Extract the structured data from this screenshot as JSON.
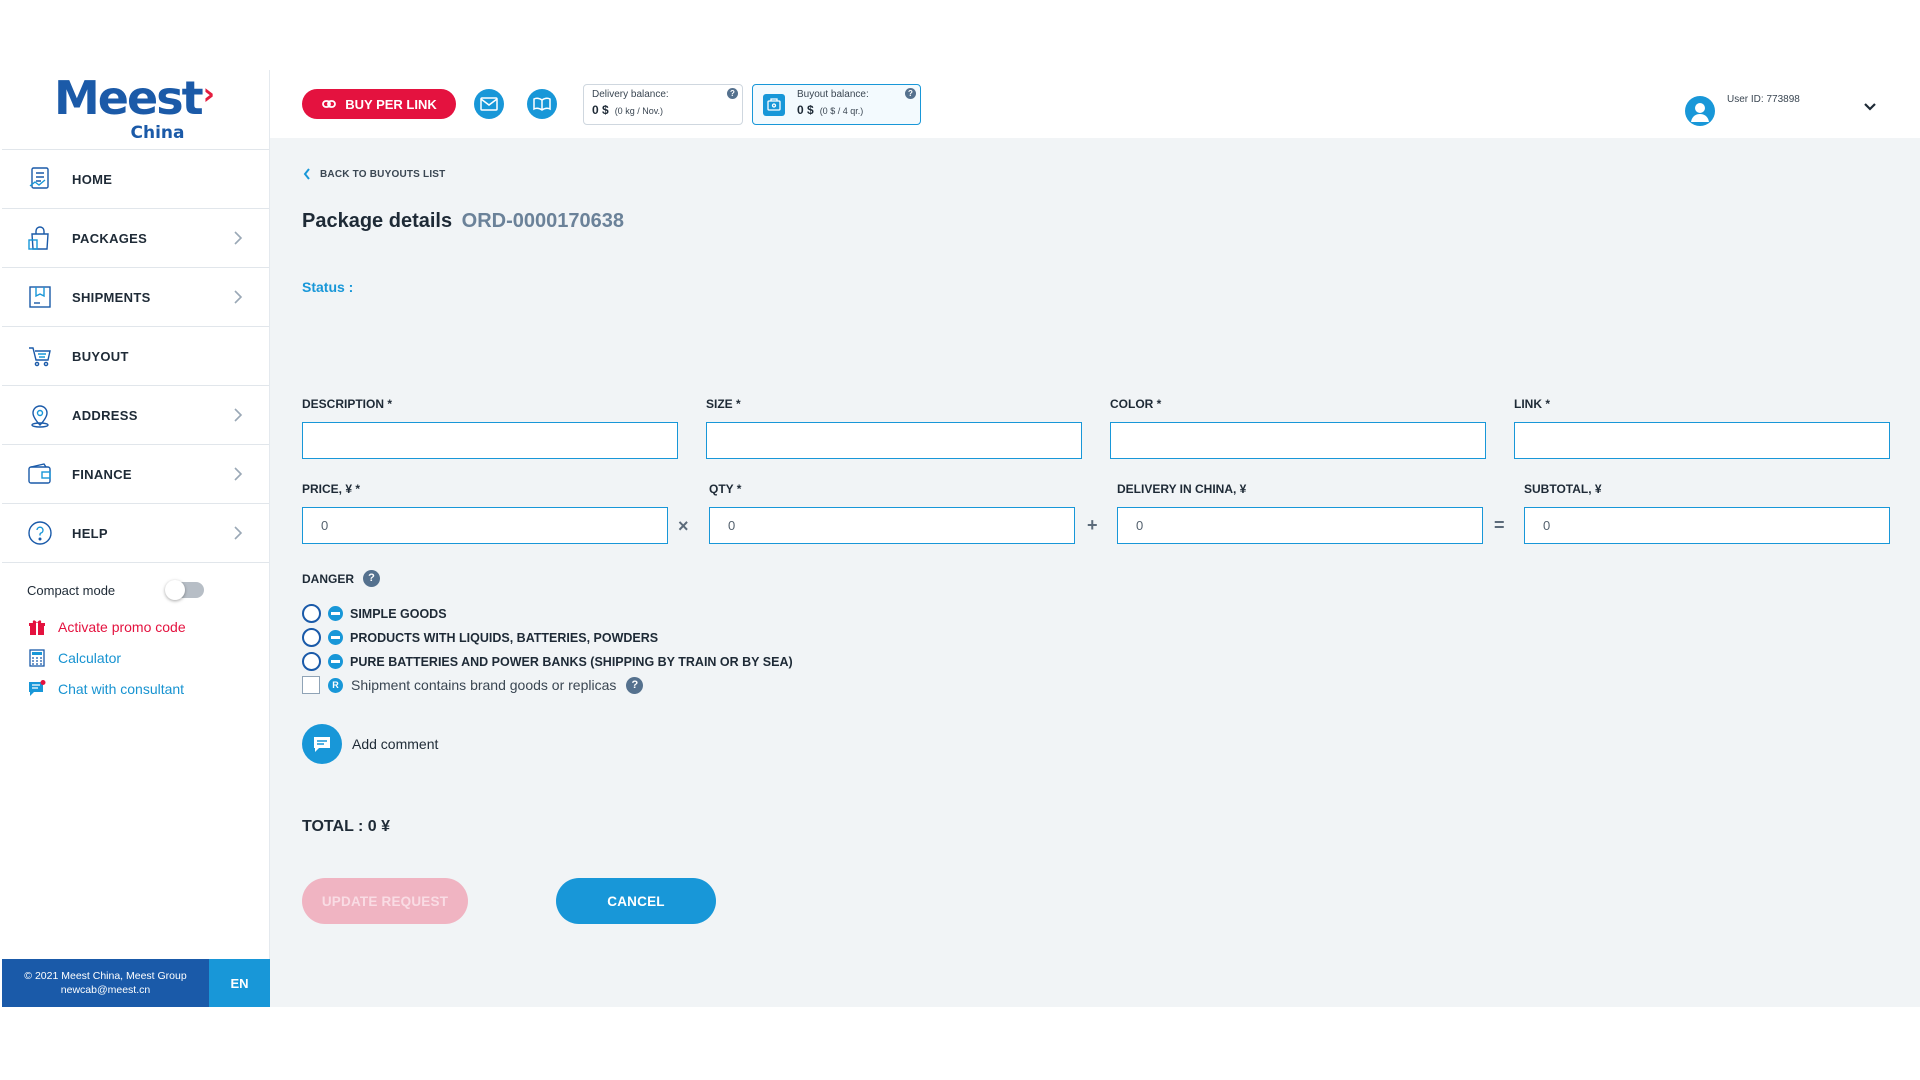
{
  "colors": {
    "accent_blue": "#1897d8",
    "brand_blue": "#1a5aa9",
    "brand_red": "#e4123f",
    "background": "#f1f4f6"
  },
  "logo": {
    "main": "Meest",
    "sub": "China"
  },
  "sidebar": {
    "items": [
      {
        "label": "HOME",
        "icon": "home-document-icon"
      },
      {
        "label": "PACKAGES",
        "icon": "shopping-bag-icon"
      },
      {
        "label": "SHIPMENTS",
        "icon": "box-icon"
      },
      {
        "label": "BUYOUT",
        "icon": "cart-icon"
      },
      {
        "label": "ADDRESS",
        "icon": "location-pin-icon"
      },
      {
        "label": "FINANCE",
        "icon": "wallet-icon"
      },
      {
        "label": "HELP",
        "icon": "help-icon"
      }
    ],
    "compact_mode_label": "Compact mode",
    "compact_mode_on": false,
    "promo": "Activate promo code",
    "calculator": "Calculator",
    "chat": "Chat with consultant",
    "footer_line1": "© 2021 Meest China, Meest Group",
    "footer_line2": "newcab@meest.cn",
    "lang": "EN"
  },
  "topbar": {
    "buy_per_link": "BUY PER LINK",
    "delivery_balance": {
      "label": "Delivery balance:",
      "value": "0 $",
      "detail": "(0 kg / Nov.)"
    },
    "buyout_balance": {
      "label": "Buyout balance:",
      "value": "0 $",
      "detail": "(0 $ / 4 qr.)"
    },
    "user_id": "User ID: 773898"
  },
  "main": {
    "back_link": "BACK TO BUYOUTS LIST",
    "title": "Package details",
    "order_id": "ORD-0000170638",
    "status_label": "Status :",
    "fields": {
      "description_label": "DESCRIPTION *",
      "description_value": "",
      "size_label": "SIZE  *",
      "size_value": "",
      "color_label": "COLOR *",
      "color_value": "",
      "link_label": "LINK *",
      "link_value": "",
      "price_label": "PRICE, ¥ *",
      "price_value": "0",
      "qty_label": "QTY *",
      "qty_value": "0",
      "delivery_label": "DELIVERY IN CHINA, ¥",
      "delivery_value": "0",
      "subtotal_label": "SUBTOTAL, ¥",
      "subtotal_value": "0",
      "op_multiply": "×",
      "op_plus": "+",
      "op_equals": "="
    },
    "danger_label": "DANGER",
    "danger_options": [
      "SIMPLE GOODS",
      "PRODUCTS WITH LIQUIDS, BATTERIES, POWDERS",
      "PURE BATTERIES AND POWER BANKS (SHIPPING BY TRAIN OR BY SEA)"
    ],
    "brand_checkbox_label": "Shipment contains brand goods or replicas",
    "add_comment": "Add comment",
    "total": "TOTAL : 0 ¥",
    "update_button": "UPDATE REQUEST",
    "cancel_button": "CANCEL"
  }
}
